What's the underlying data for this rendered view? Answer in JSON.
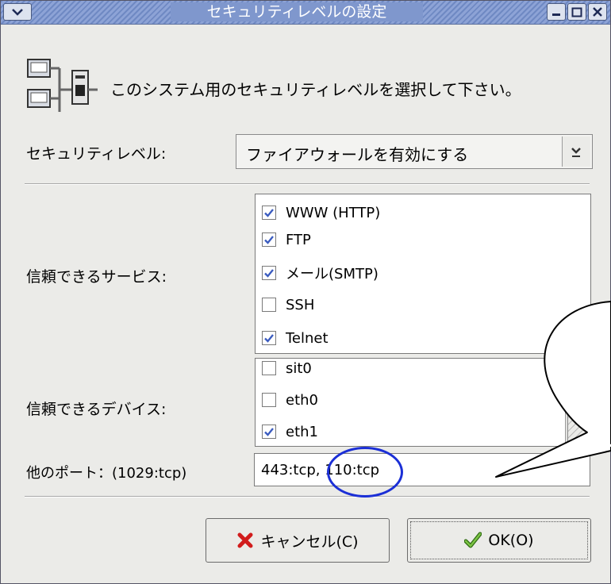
{
  "window": {
    "title": "セキュリティレベルの設定"
  },
  "header": {
    "message": "このシステム用のセキュリティレベルを選択して下さい。",
    "icon": "network-firewall-icon"
  },
  "security_level": {
    "label": "セキュリティレベル:",
    "selected": "ファイアウォールを有効にする"
  },
  "services": {
    "label": "信頼できるサービス:",
    "items": [
      {
        "label": "WWW (HTTP)",
        "checked": true
      },
      {
        "label": "FTP",
        "checked": true
      },
      {
        "label": "メール(SMTP)",
        "checked": true
      },
      {
        "label": "SSH",
        "checked": false
      },
      {
        "label": "Telnet",
        "checked": true
      }
    ]
  },
  "devices": {
    "label": "信頼できるデバイス:",
    "items": [
      {
        "label": "sit0",
        "checked": false
      },
      {
        "label": "eth0",
        "checked": false
      },
      {
        "label": "eth1",
        "checked": true
      }
    ]
  },
  "other_ports": {
    "label": "他のポート：(1029:tcp)",
    "value": "443:tcp, 110:tcp"
  },
  "buttons": {
    "cancel": "キャンセル(C)",
    "ok": "OK(O)"
  },
  "colors": {
    "accent": "#1b2fd6",
    "check": "#3a5bbf",
    "cancel_icon": "#d11c1c",
    "ok_icon": "#5aa02c"
  }
}
